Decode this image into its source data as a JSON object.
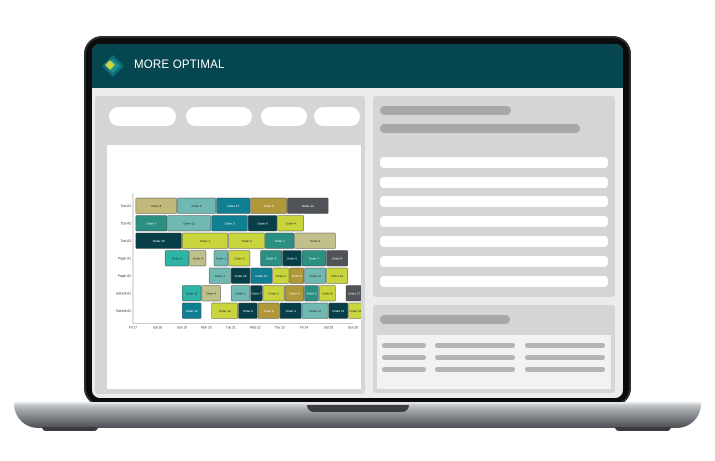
{
  "app": {
    "brand": "MORE OPTIMAL"
  },
  "colors": {
    "header": "#054651",
    "logo_accent": "#c9d53c",
    "panel": "#d4d5d6"
  },
  "chart_data": {
    "type": "gantt",
    "rows": [
      "Tool A1",
      "Tool A2",
      "Tool A3",
      "Paper A1",
      "Paper A2",
      "Solvent A1",
      "Solvent A2"
    ],
    "x_ticks": [
      "Fri 17",
      "Sat 18",
      "Sun 19",
      "Mon 20",
      "Tue 21",
      "Wed 22",
      "Thu 23",
      "Fri 24",
      "Sat 25",
      "Sun 26"
    ],
    "bars": [
      {
        "row": 0,
        "start": 0.1,
        "end": 1.8,
        "label": "Order 8",
        "color": "#c0b97a"
      },
      {
        "row": 0,
        "start": 1.8,
        "end": 3.4,
        "label": "Order 5",
        "color": "#70b9b2"
      },
      {
        "row": 0,
        "start": 3.4,
        "end": 4.8,
        "label": "Order 17",
        "color": "#0f7f91"
      },
      {
        "row": 0,
        "start": 4.8,
        "end": 6.3,
        "label": "Order 9",
        "color": "#b0983a"
      },
      {
        "row": 0,
        "start": 6.3,
        "end": 8.0,
        "label": "Order 14",
        "color": "#505357"
      },
      {
        "row": 1,
        "start": 0.1,
        "end": 1.4,
        "label": "Order 7",
        "color": "#2b8f82"
      },
      {
        "row": 1,
        "start": 1.4,
        "end": 3.2,
        "label": "Order 12",
        "color": "#70b9b2"
      },
      {
        "row": 1,
        "start": 3.2,
        "end": 4.7,
        "label": "Order 3",
        "color": "#0f7f91"
      },
      {
        "row": 1,
        "start": 4.7,
        "end": 5.9,
        "label": "Order 6",
        "color": "#063f48"
      },
      {
        "row": 1,
        "start": 5.9,
        "end": 7.0,
        "label": "Order 4",
        "color": "#c9d53c"
      },
      {
        "row": 2,
        "start": 0.1,
        "end": 2.0,
        "label": "Order 16",
        "color": "#063f48"
      },
      {
        "row": 2,
        "start": 2.0,
        "end": 3.9,
        "label": "Order 1",
        "color": "#c9d53c"
      },
      {
        "row": 2,
        "start": 3.9,
        "end": 5.4,
        "label": "Order 2",
        "color": "#c9d53c"
      },
      {
        "row": 2,
        "start": 5.4,
        "end": 6.6,
        "label": "Order 7",
        "color": "#2b8f82"
      },
      {
        "row": 2,
        "start": 6.6,
        "end": 8.3,
        "label": "Order 3",
        "color": "#c0c08a"
      },
      {
        "row": 3,
        "start": 1.3,
        "end": 2.3,
        "label": "Order 3",
        "color": "#2fb3a4"
      },
      {
        "row": 3,
        "start": 2.3,
        "end": 3.0,
        "label": "Order 6",
        "color": "#c0c08a"
      },
      {
        "row": 3,
        "start": 3.3,
        "end": 3.9,
        "label": "Order 1",
        "color": "#70b9b2"
      },
      {
        "row": 3,
        "start": 3.9,
        "end": 4.8,
        "label": "Order 2",
        "color": "#c9d53c"
      },
      {
        "row": 3,
        "start": 5.2,
        "end": 6.1,
        "label": "Order 4",
        "color": "#2b8f82"
      },
      {
        "row": 3,
        "start": 6.1,
        "end": 6.9,
        "label": "Order 5",
        "color": "#063f48"
      },
      {
        "row": 3,
        "start": 6.9,
        "end": 7.9,
        "label": "Order 7",
        "color": "#2b8f82"
      },
      {
        "row": 3,
        "start": 7.9,
        "end": 8.8,
        "label": "Order 8",
        "color": "#505357"
      },
      {
        "row": 4,
        "start": 3.1,
        "end": 4.0,
        "label": "Order 1",
        "color": "#70b9b2"
      },
      {
        "row": 4,
        "start": 4.0,
        "end": 4.8,
        "label": "Order 16",
        "color": "#063f48"
      },
      {
        "row": 4,
        "start": 4.8,
        "end": 5.7,
        "label": "Order 14",
        "color": "#0f7f91"
      },
      {
        "row": 4,
        "start": 5.7,
        "end": 6.4,
        "label": "Order 2",
        "color": "#c9d53c"
      },
      {
        "row": 4,
        "start": 6.4,
        "end": 7.0,
        "label": "Order 9",
        "color": "#b0983a"
      },
      {
        "row": 4,
        "start": 7.0,
        "end": 7.9,
        "label": "Order 11",
        "color": "#70b9b2"
      },
      {
        "row": 4,
        "start": 7.9,
        "end": 8.8,
        "label": "Order 12",
        "color": "#c9d53c"
      },
      {
        "row": 5,
        "start": 2.0,
        "end": 2.8,
        "label": "Order 11",
        "color": "#2fb3a4"
      },
      {
        "row": 5,
        "start": 2.8,
        "end": 3.6,
        "label": "Order 4",
        "color": "#c0c08a"
      },
      {
        "row": 5,
        "start": 4.0,
        "end": 4.8,
        "label": "Order 1",
        "color": "#70b9b2"
      },
      {
        "row": 5,
        "start": 4.8,
        "end": 5.3,
        "label": "Order 7",
        "color": "#063f48"
      },
      {
        "row": 5,
        "start": 5.3,
        "end": 6.2,
        "label": "Order 2",
        "color": "#c9d53c"
      },
      {
        "row": 5,
        "start": 6.2,
        "end": 7.0,
        "label": "Order 9",
        "color": "#b0983a"
      },
      {
        "row": 5,
        "start": 7.0,
        "end": 7.6,
        "label": "Order 3",
        "color": "#2b8f82"
      },
      {
        "row": 5,
        "start": 7.6,
        "end": 8.3,
        "label": "Order 8",
        "color": "#c9d53c"
      },
      {
        "row": 5,
        "start": 8.7,
        "end": 9.4,
        "label": "Order 17",
        "color": "#505357"
      },
      {
        "row": 6,
        "start": 2.0,
        "end": 2.8,
        "label": "Order 14",
        "color": "#0f7f91"
      },
      {
        "row": 6,
        "start": 3.2,
        "end": 4.3,
        "label": "Order 12",
        "color": "#c9d53c"
      },
      {
        "row": 6,
        "start": 4.3,
        "end": 5.1,
        "label": "Order 9",
        "color": "#063f48"
      },
      {
        "row": 6,
        "start": 5.1,
        "end": 6.0,
        "label": "Order 6",
        "color": "#b0983a"
      },
      {
        "row": 6,
        "start": 6.0,
        "end": 6.9,
        "label": "Order 4",
        "color": "#063f48"
      },
      {
        "row": 6,
        "start": 6.9,
        "end": 8.0,
        "label": "Order 11",
        "color": "#70b9b2"
      },
      {
        "row": 6,
        "start": 8.0,
        "end": 8.8,
        "label": "Order 14",
        "color": "#063f48"
      },
      {
        "row": 6,
        "start": 8.8,
        "end": 9.4,
        "label": "Order 16",
        "color": "#c9d53c"
      },
      {
        "row": 6,
        "start": 9.4,
        "end": 9.9,
        "label": "Order 2",
        "color": "#c0c08a"
      }
    ]
  }
}
